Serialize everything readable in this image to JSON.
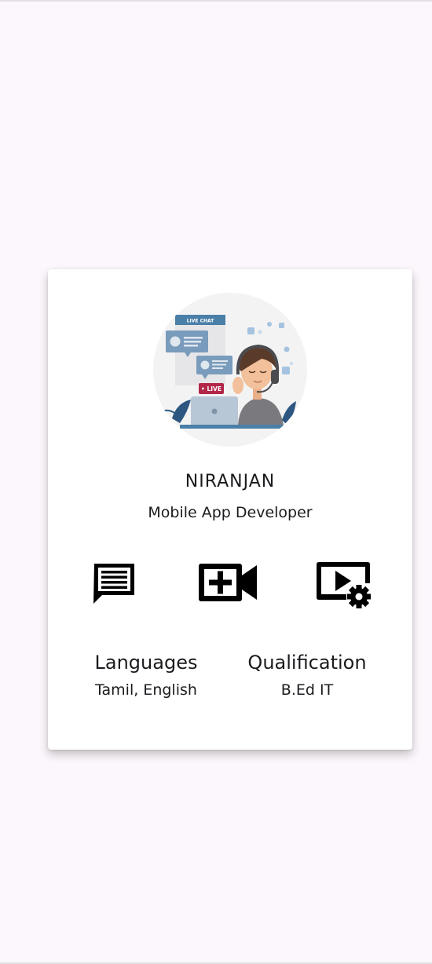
{
  "profile": {
    "name": "NIRANJAN",
    "role": "Mobile App Developer",
    "avatar_icon": "live-chat-support-illustration",
    "avatar_text": {
      "live_chat": "LIVE CHAT",
      "live": "• LIVE"
    }
  },
  "actions": [
    {
      "icon": "chat-icon"
    },
    {
      "icon": "video-call-add-icon"
    },
    {
      "icon": "video-settings-icon"
    }
  ],
  "info": {
    "languages_label": "Languages",
    "languages_value": "Tamil, English",
    "qualification_label": "Qualification",
    "qualification_value": "B.Ed IT"
  },
  "colors": {
    "background": "#fcf7fc",
    "card": "#ffffff",
    "text": "#1b1b1f",
    "icon": "#000000",
    "chat_header": "#4a7fa8",
    "live_badge": "#b3264a"
  }
}
